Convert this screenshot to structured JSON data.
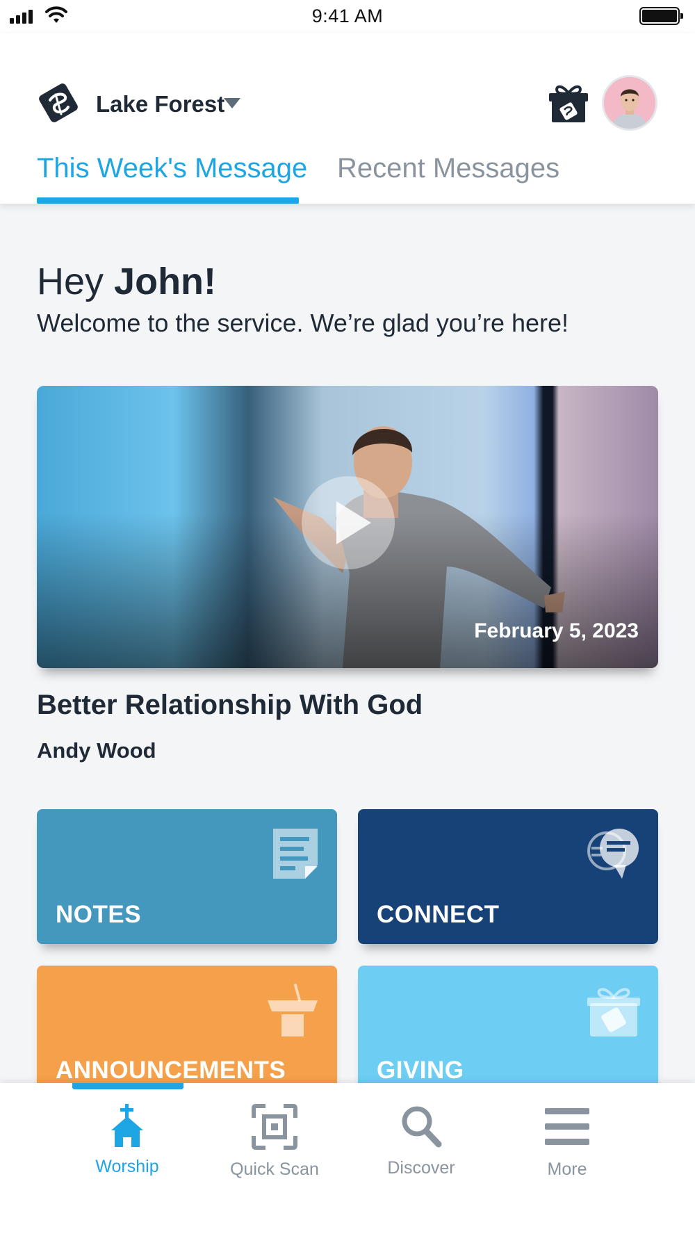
{
  "status_bar": {
    "time": "9:41 AM"
  },
  "header": {
    "campus_name": "Lake Forest",
    "logo_icon": "church-logo-icon",
    "gift_icon": "gift-icon",
    "avatar_icon": "user-avatar",
    "tabs": [
      {
        "label": "This Week's Message",
        "active": true
      },
      {
        "label": "Recent Messages",
        "active": false
      }
    ]
  },
  "greeting": {
    "hey": "Hey",
    "name": "John!",
    "welcome": "Welcome to the service. We’re glad you’re here!"
  },
  "message": {
    "date": "February 5, 2023",
    "title": "Better Relationship With God",
    "speaker": "Andy Wood",
    "play_icon": "play-icon"
  },
  "tiles": [
    {
      "label": "NOTES",
      "icon": "notes-icon",
      "color": "#4497bd"
    },
    {
      "label": "CONNECT",
      "icon": "chat-bubble-icon",
      "color": "#164277"
    },
    {
      "label": "ANNOUNCEMENTS",
      "icon": "podium-icon",
      "color": "#f5a04a"
    },
    {
      "label": "GIVING",
      "icon": "gift-icon",
      "color": "#6dcdf2"
    }
  ],
  "bottom_nav": [
    {
      "label": "Worship",
      "icon": "church-icon",
      "active": true
    },
    {
      "label": "Quick Scan",
      "icon": "scan-icon",
      "active": false
    },
    {
      "label": "Discover",
      "icon": "search-icon",
      "active": false
    },
    {
      "label": "More",
      "icon": "menu-icon",
      "active": false
    }
  ],
  "colors": {
    "accent": "#1ea5e4",
    "text_dark": "#1f2a36",
    "text_muted": "#8a949e"
  }
}
